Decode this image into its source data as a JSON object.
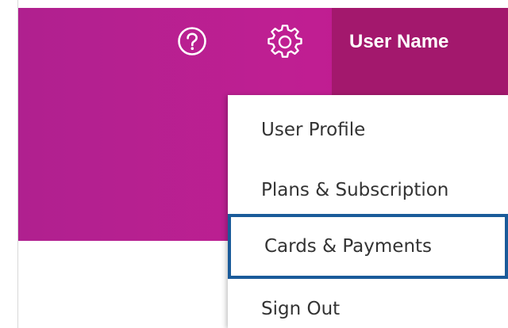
{
  "header": {
    "help_icon": "question-circle-icon",
    "settings_icon": "gear-icon",
    "user_name": "User Name"
  },
  "user_menu": {
    "items": [
      {
        "label": "User Profile"
      },
      {
        "label": "Plans & Subscription"
      },
      {
        "label": "Cards & Payments",
        "focused": true
      },
      {
        "label": "Sign Out"
      }
    ]
  },
  "colors": {
    "header_magenta": "#bf1f92",
    "user_area": "#a3186d",
    "focus_outline": "#1a5b9a",
    "menu_text": "#333333"
  }
}
